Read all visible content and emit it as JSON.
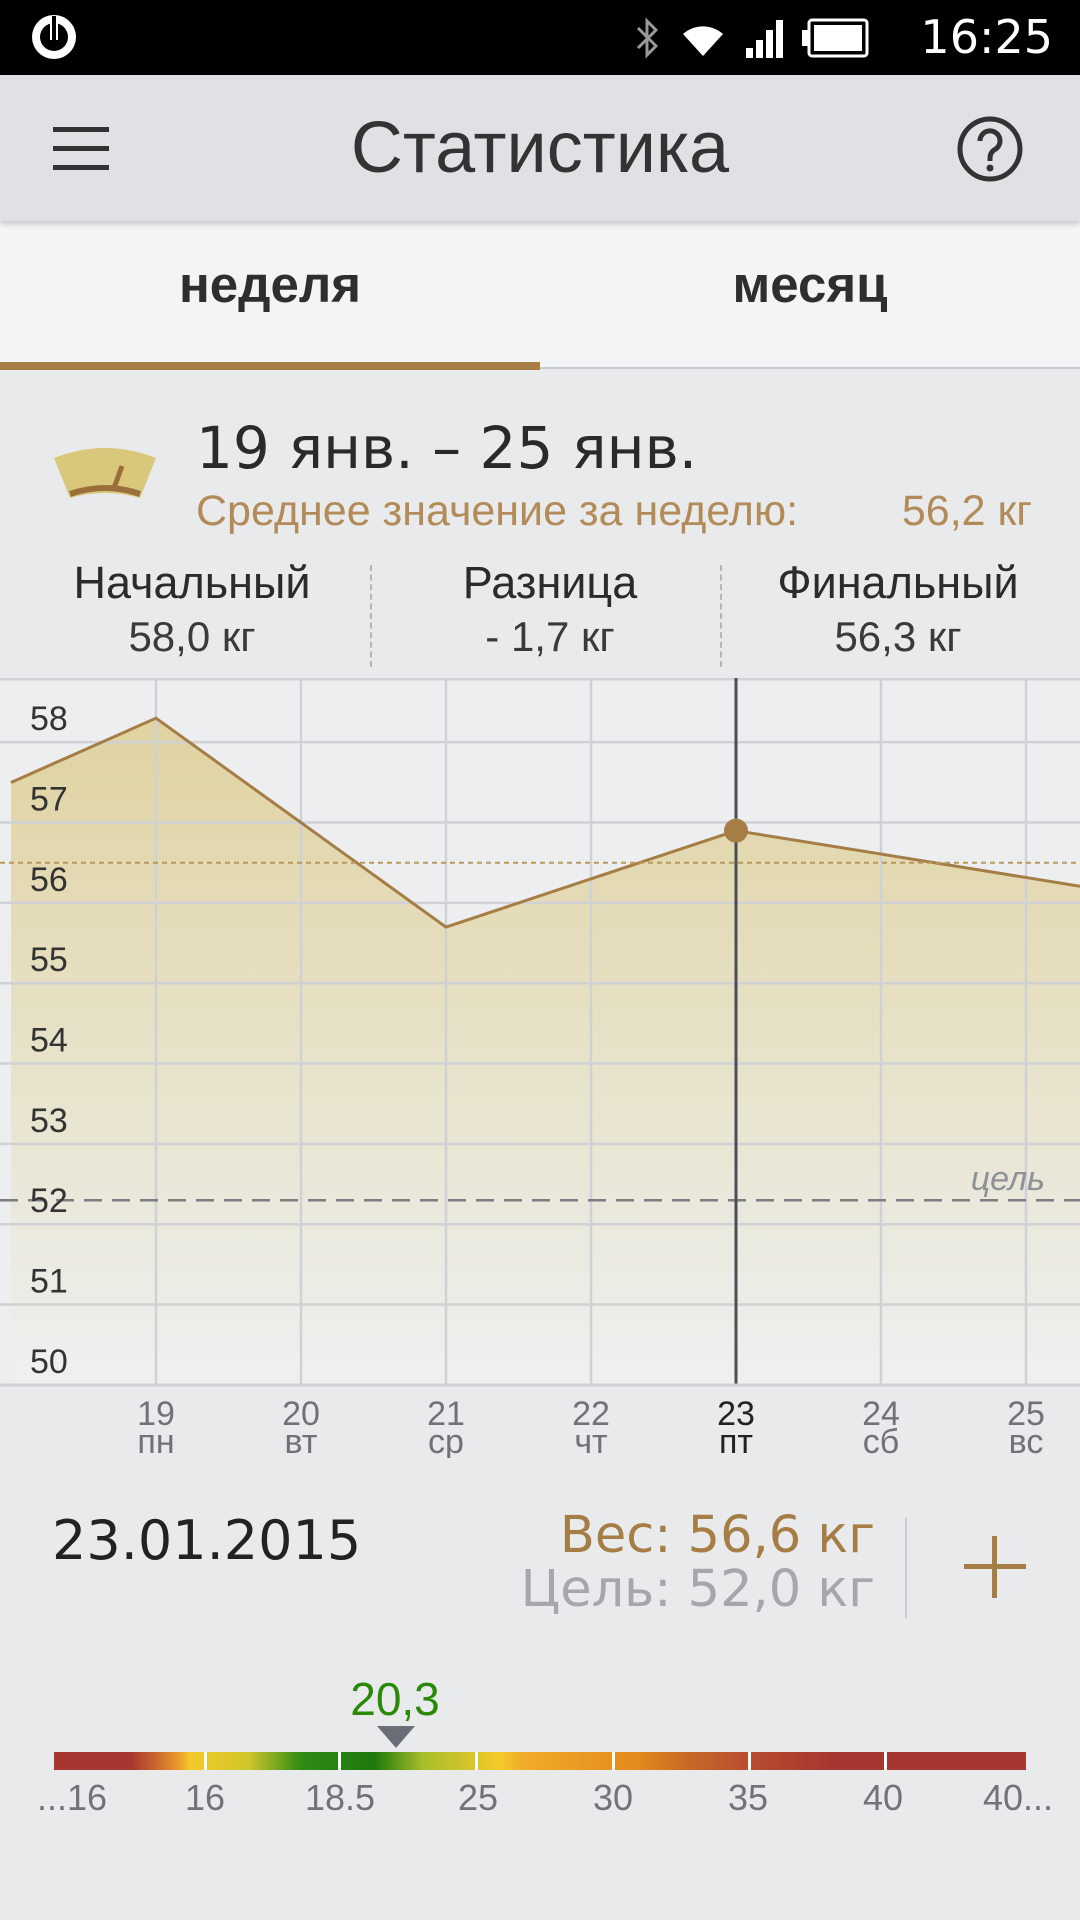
{
  "status_bar": {
    "time": "16:25",
    "icons": [
      "app-logo-icon",
      "bluetooth-icon",
      "wifi-icon",
      "signal-icon",
      "battery-icon"
    ]
  },
  "app_bar": {
    "title": "Статистика",
    "icons": [
      "menu-icon",
      "help-icon"
    ]
  },
  "tabs": [
    {
      "label": "неделя",
      "selected": true
    },
    {
      "label": "месяц",
      "selected": false
    }
  ],
  "week": {
    "range": "19 янв. – 25 янв.",
    "average_label": "Среднее значение за неделю:",
    "average_value": "56,2 кг",
    "summary": {
      "start_label": "Начальный",
      "start_value": "58,0 кг",
      "diff_label": "Разница",
      "diff_value": "- 1,7 кг",
      "final_label": "Финальный",
      "final_value": "56,3 кг"
    }
  },
  "chart_data": {
    "type": "area",
    "y_ticks": [
      "58",
      "57",
      "56",
      "55",
      "54",
      "53",
      "52",
      "51",
      "50"
    ],
    "ylim": [
      49.7,
      58.5
    ],
    "x_days": [
      {
        "day": "19",
        "weekday": "пн"
      },
      {
        "day": "20",
        "weekday": "вт"
      },
      {
        "day": "21",
        "weekday": "ср"
      },
      {
        "day": "22",
        "weekday": "чт"
      },
      {
        "day": "23",
        "weekday": "пт"
      },
      {
        "day": "24",
        "weekday": "сб"
      },
      {
        "day": "25",
        "weekday": "вс"
      }
    ],
    "series": [
      {
        "x": [
          18,
          19,
          21,
          23,
          25.4
        ],
        "values": [
          57.2,
          58.0,
          55.4,
          56.6,
          55.9
        ]
      }
    ],
    "average_line": 56.2,
    "goal_line": 52.0,
    "goal_label": "цель",
    "selected_day": 23,
    "colors": {
      "line": "#a57d45",
      "fill": "#e2d6a4",
      "goal": "#7a7d82",
      "cursor": "#4a4e56",
      "grid": "#cfd1d4"
    },
    "grid": true
  },
  "selected_entry": {
    "date": "23.01.2015",
    "weight": "Вес: 56,6 кг",
    "goal": "Цель: 52,0 кг",
    "add_icon": "plus-icon"
  },
  "bmi": {
    "value": "20,3",
    "pointer_value": 20.3,
    "scale_labels": [
      "...16",
      "16",
      "18.5",
      "25",
      "30",
      "35",
      "40",
      "40..."
    ]
  }
}
